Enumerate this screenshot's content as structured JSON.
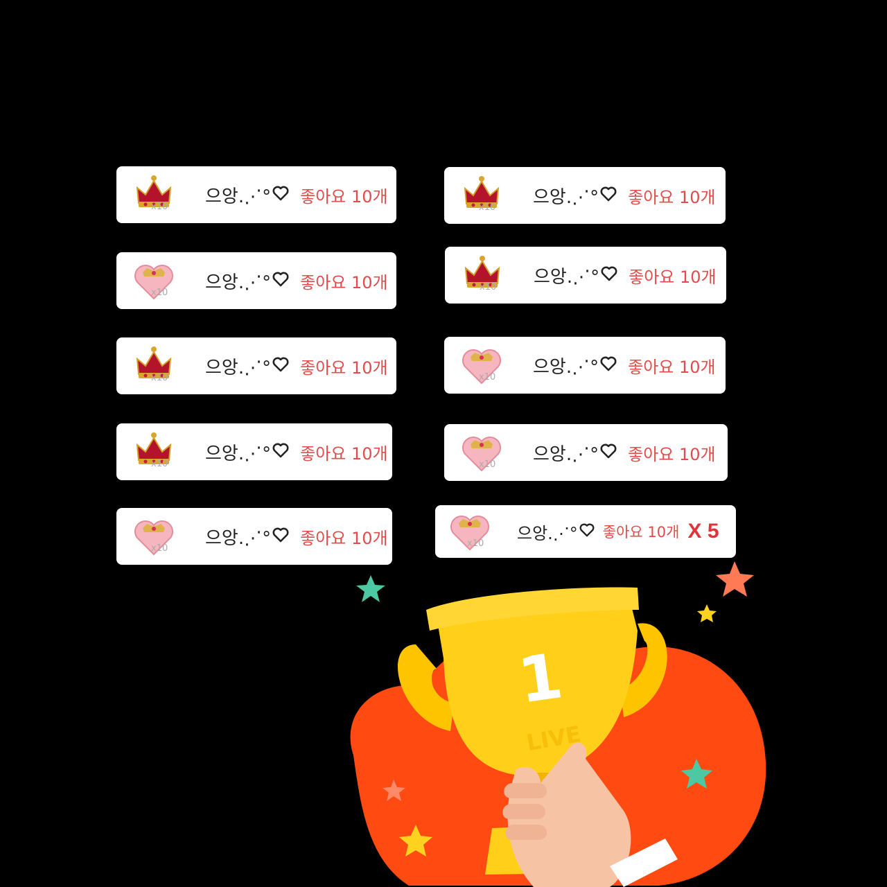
{
  "cards_left": [
    {
      "gift_icon": "crown-gift",
      "gift_count": "x10",
      "name": "으앙.⋰°",
      "likes": "좋아요 10개"
    },
    {
      "gift_icon": "pink-heart-gift",
      "gift_count": "x10",
      "name": "으앙.⋰°",
      "likes": "좋아요 10개"
    },
    {
      "gift_icon": "crown-gift",
      "gift_count": "x10",
      "name": "으앙.⋰°",
      "likes": "좋아요 10개"
    },
    {
      "gift_icon": "crown-gift",
      "gift_count": "x10",
      "name": "으앙.⋰°",
      "likes": "좋아요 10개"
    },
    {
      "gift_icon": "pink-heart-gift",
      "gift_count": "x10",
      "name": "으앙.⋰°",
      "likes": "좋아요 10개"
    }
  ],
  "cards_right": [
    {
      "gift_icon": "crown-gift",
      "gift_count": "x10",
      "name": "으앙.⋰°",
      "likes": "좋아요 10개"
    },
    {
      "gift_icon": "crown-gift",
      "gift_count": "x10",
      "name": "으앙.⋰°",
      "likes": "좋아요 10개"
    },
    {
      "gift_icon": "pink-heart-gift",
      "gift_count": "x10",
      "name": "으앙.⋰°",
      "likes": "좋아요 10개"
    },
    {
      "gift_icon": "pink-heart-gift",
      "gift_count": "x10",
      "name": "으앙.⋰°",
      "likes": "좋아요 10개"
    },
    {
      "gift_icon": "pink-heart-gift",
      "gift_count": "x10",
      "name": "으앙.⋰°",
      "likes": "좋아요 10개",
      "multiplier": "X 5"
    }
  ],
  "trophy": {
    "rank": "1",
    "label": "LIVE"
  },
  "colors": {
    "background": "#000000",
    "likes_text": "#e34b4b",
    "multiplier": "#e0333a",
    "blob": "#ff4a12",
    "trophy": "#ffc400"
  }
}
